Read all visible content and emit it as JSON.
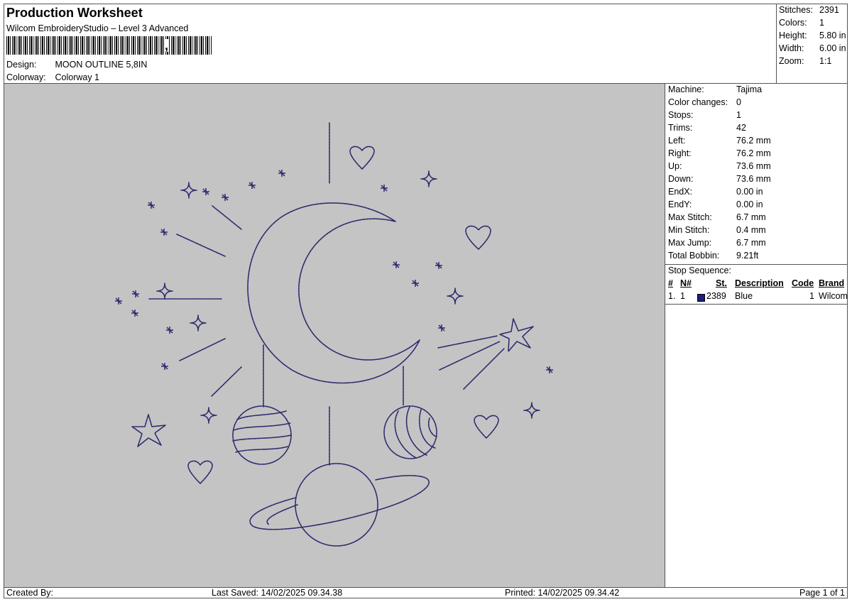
{
  "header": {
    "title": "Production Worksheet",
    "software": "Wilcom EmbroideryStudio – Level 3 Advanced",
    "design_label": "Design:",
    "design_value": "MOON OUTLINE 5,8IN",
    "colorway_label": "Colorway:",
    "colorway_value": "Colorway 1"
  },
  "summary": [
    {
      "label": "Stitches:",
      "value": "2391"
    },
    {
      "label": "Colors:",
      "value": "1"
    },
    {
      "label": "Height:",
      "value": "5.80 in"
    },
    {
      "label": "Width:",
      "value": "6.00 in"
    },
    {
      "label": "Zoom:",
      "value": "1:1"
    }
  ],
  "details": [
    {
      "label": "Machine:",
      "value": "Tajima"
    },
    {
      "label": "Color changes:",
      "value": "0"
    },
    {
      "label": "Stops:",
      "value": "1"
    },
    {
      "label": "Trims:",
      "value": "42"
    },
    {
      "label": "Left:",
      "value": "76.2 mm"
    },
    {
      "label": "Right:",
      "value": "76.2 mm"
    },
    {
      "label": "Up:",
      "value": "73.6 mm"
    },
    {
      "label": "Down:",
      "value": "73.6 mm"
    },
    {
      "label": "EndX:",
      "value": "0.00 in"
    },
    {
      "label": "EndY:",
      "value": "0.00 in"
    },
    {
      "label": "Max Stitch:",
      "value": "6.7 mm"
    },
    {
      "label": "Min Stitch:",
      "value": "0.4 mm"
    },
    {
      "label": "Max Jump:",
      "value": "6.7 mm"
    },
    {
      "label": "Total Bobbin:",
      "value": "9.21ft"
    }
  ],
  "stop_sequence": {
    "title": "Stop Sequence:",
    "headers": {
      "num": "#",
      "n": "N#",
      "st": "St.",
      "description": "Description",
      "code": "Code",
      "brand": "Brand"
    },
    "rows": [
      {
        "num": "1.",
        "n": "1",
        "color": "#1f1f7a",
        "st": "2389",
        "description": "Blue",
        "code": "1",
        "brand": "Wilcom"
      }
    ]
  },
  "footer": {
    "created_by": "Created By:",
    "last_saved": "Last Saved: 14/02/2025 09.34.38",
    "printed": "Printed: 14/02/2025 09.34.42",
    "page": "Page 1 of 1"
  },
  "colors": {
    "thread": "#2c2a6e",
    "canvas": "#c4c4c4"
  }
}
